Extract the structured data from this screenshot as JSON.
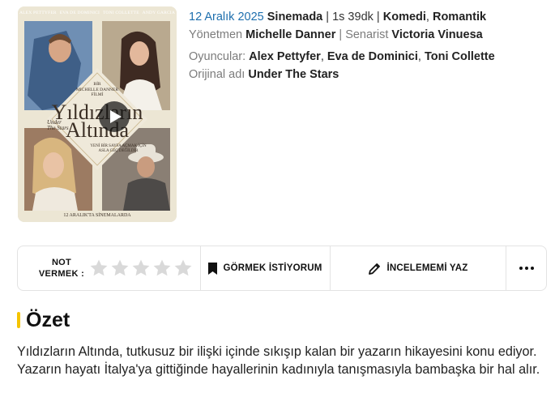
{
  "poster": {
    "cast": [
      "ALEX PETTYFER",
      "EVA DE DOMINICI",
      "TONI COLLETTE",
      "ANDY GARCIA"
    ],
    "director_credit_line1": "BİR",
    "director_credit_line2": "MICHELLE DANNER",
    "director_credit_line3": "FİLMİ",
    "title_line1": "Yıldızların",
    "title_line2": "Altında",
    "title_en_line1": "Under",
    "title_en_line2": "The Stars",
    "tagline_line1": "YENİ BİR SAYFA AÇMAK İÇİN",
    "tagline_line2": "ASLA GEÇ DEĞİLDİR",
    "release": "12 ARALIK'TA SİNEMALARDA"
  },
  "info": {
    "release_date": "12 Aralık 2025",
    "release_status": "Sinemada",
    "separator": "|",
    "duration": "1s 39dk",
    "genres": [
      "Komedi",
      "Romantik"
    ],
    "director_label": "Yönetmen",
    "director": "Michelle Danner",
    "writer_label": "Senarist",
    "writer": "Victoria Vinuesa",
    "cast_label": "Oyuncular:",
    "cast": [
      "Alex Pettyfer",
      "Eva de Dominici",
      "Toni Collette"
    ],
    "original_title_label": "Orijinal adı",
    "original_title": "Under The Stars"
  },
  "actions": {
    "rate_label_line1": "NOT",
    "rate_label_line2": "VERMEK :",
    "rating_value": 0,
    "rating_max": 5,
    "watchlist_label": "GÖRMEK İSTİYORUM",
    "review_label": "İNCELEMEMİ YAZ"
  },
  "summary": {
    "title": "Özet",
    "text": "Yıldızların Altında, tutkusuz bir ilişki içinde sıkışıp kalan bir yazarın hikayesini konu ediyor. Yazarın hayatı İtalya'ya gittiğinde hayallerinin kadınıyla tanışmasıyla bambaşka bir hal alır."
  },
  "colors": {
    "accent": "#f5c400",
    "link_blue": "#1e6fae",
    "star_empty": "#d9d9d9",
    "muted": "#7c7c7c"
  }
}
